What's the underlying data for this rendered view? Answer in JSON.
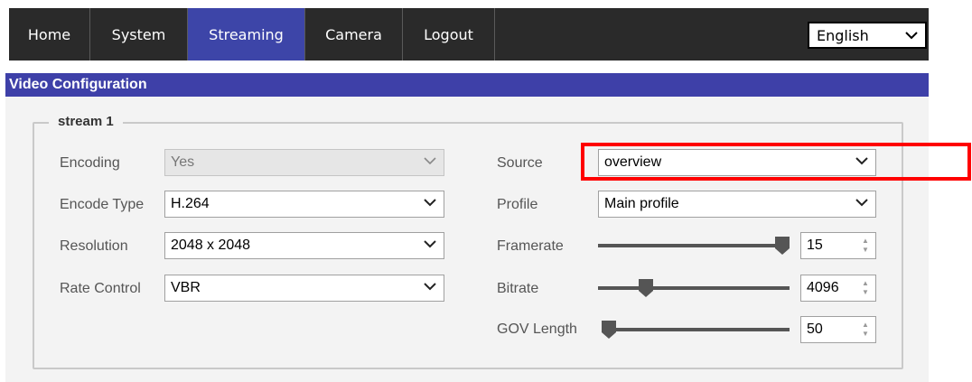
{
  "nav": {
    "tabs": [
      {
        "label": "Home"
      },
      {
        "label": "System"
      },
      {
        "label": "Streaming"
      },
      {
        "label": "Camera"
      },
      {
        "label": "Logout"
      }
    ],
    "active_tab": "Streaming",
    "language": "English"
  },
  "section": {
    "title": "Video Configuration",
    "stream_legend": "stream 1"
  },
  "left_fields": {
    "encoding": {
      "label": "Encoding",
      "value": "Yes",
      "disabled": true
    },
    "encode_type": {
      "label": "Encode Type",
      "value": "H.264"
    },
    "resolution": {
      "label": "Resolution",
      "value": "2048 x 2048"
    },
    "rate_control": {
      "label": "Rate Control",
      "value": "VBR"
    }
  },
  "right_fields": {
    "source": {
      "label": "Source",
      "value": "overview"
    },
    "profile": {
      "label": "Profile",
      "value": "Main profile"
    },
    "framerate": {
      "label": "Framerate",
      "value": "15",
      "slider_fraction": 1.0
    },
    "bitrate": {
      "label": "Bitrate",
      "value": "4096",
      "slider_fraction": 0.23
    },
    "gov_length": {
      "label": "GOV Length",
      "value": "50",
      "slider_fraction": 0.0
    }
  },
  "icons": {
    "dropdown": "chevron-down-icon",
    "spinner": "spinner-arrows-icon",
    "slider_thumb": "slider-thumb-icon"
  },
  "colors": {
    "nav_bg": "#2a2a2a",
    "active_tab": "#3d45a8",
    "header_bg": "#3e40a8",
    "highlight": "#ff0000"
  }
}
